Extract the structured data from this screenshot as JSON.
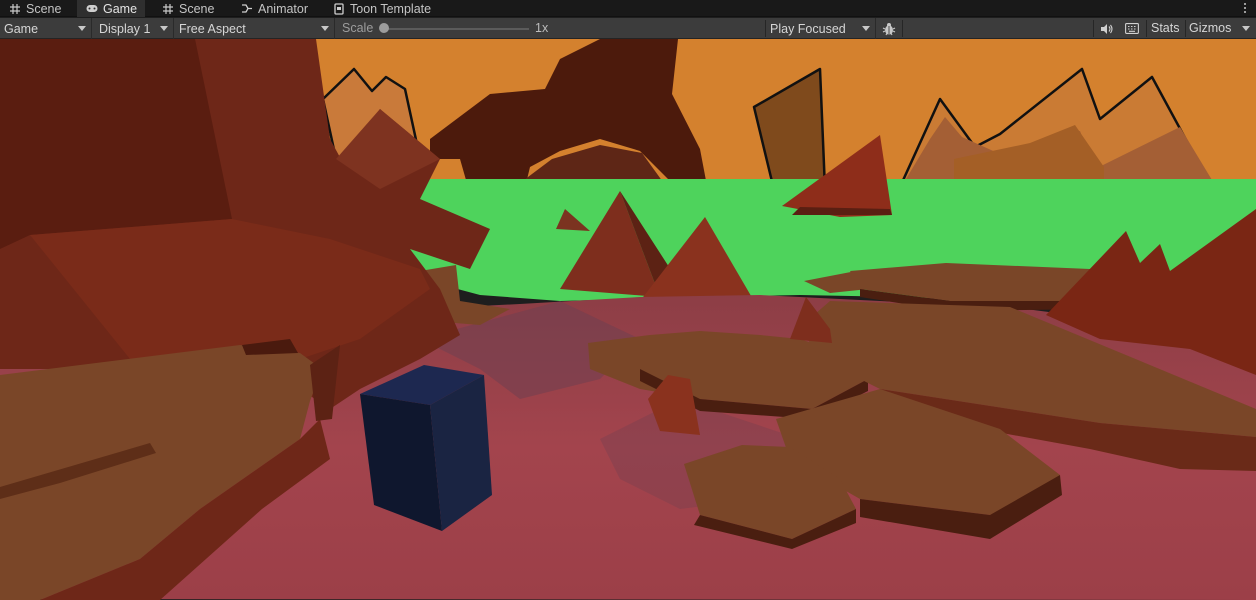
{
  "tabs": [
    {
      "label": "Scene",
      "icon": "grid-icon"
    },
    {
      "label": "Game",
      "icon": "gamepad-icon",
      "active": true
    },
    {
      "label": "Scene",
      "icon": "grid-icon"
    },
    {
      "label": "Animator",
      "icon": "animator-icon"
    },
    {
      "label": "Toon Template",
      "icon": "document-icon"
    }
  ],
  "toolbar": {
    "view_mode": "Game",
    "display": "Display 1",
    "aspect": "Free Aspect",
    "scale_label": "Scale",
    "scale_value": "1x",
    "play_mode": "Play Focused",
    "stats": "Stats",
    "gizmos": "Gizmos"
  },
  "icons": {
    "bug": "bug-icon",
    "audio": "speaker-icon",
    "keyboard": "keyboard-icon",
    "more": "more-vertical-icon"
  },
  "colors": {
    "sky": "#d4812e",
    "grass": "#4ed35c",
    "ground": "#a3444d",
    "rock": "#6e2718",
    "platform": "#7a4628",
    "cube": "#1a2442"
  }
}
